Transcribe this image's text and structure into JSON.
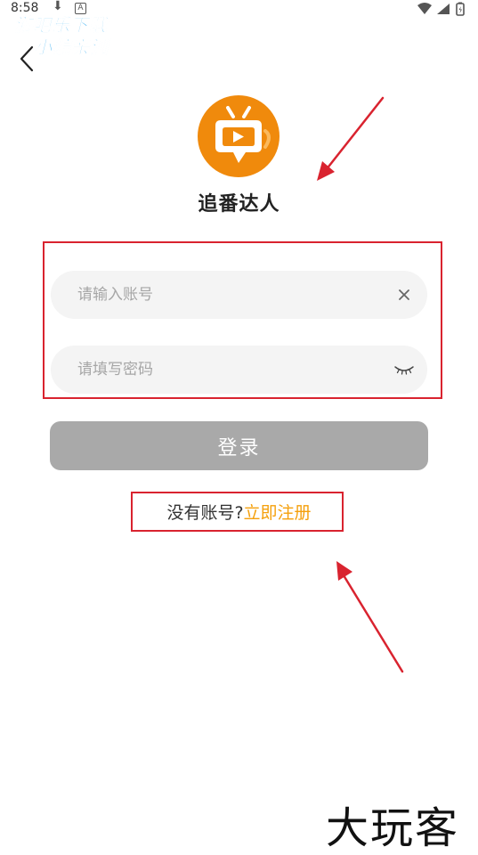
{
  "status_bar": {
    "time": "8:58",
    "download_icon": "download-icon",
    "notification_badge": "A",
    "wifi_icon": "wifi-icon",
    "signal_icon": "signal-icon",
    "battery_icon": "battery-icon"
  },
  "watermark": {
    "line1": "游吧乐下载",
    "line2": "小编亲测"
  },
  "header": {
    "back_icon": "back-chevron-icon"
  },
  "app": {
    "logo_icon": "tv-play-logo-icon",
    "name": "追番达人"
  },
  "form": {
    "account_placeholder": "请输入账号",
    "account_value": "",
    "clear_icon": "clear-x-icon",
    "password_placeholder": "请填写密码",
    "password_value": "",
    "password_toggle_icon": "eye-closed-icon",
    "login_label": "登录"
  },
  "register": {
    "prompt": "没有账号?",
    "link": "立即注册"
  },
  "corner_mark": "大玩客",
  "colors": {
    "brand_orange": "#f08a0c",
    "link_orange": "#f5a00c",
    "button_disabled": "#a9a9a9",
    "input_bg": "#f4f4f4",
    "annotation_red": "#d9232f",
    "watermark_blue": "#1aa3f0"
  }
}
